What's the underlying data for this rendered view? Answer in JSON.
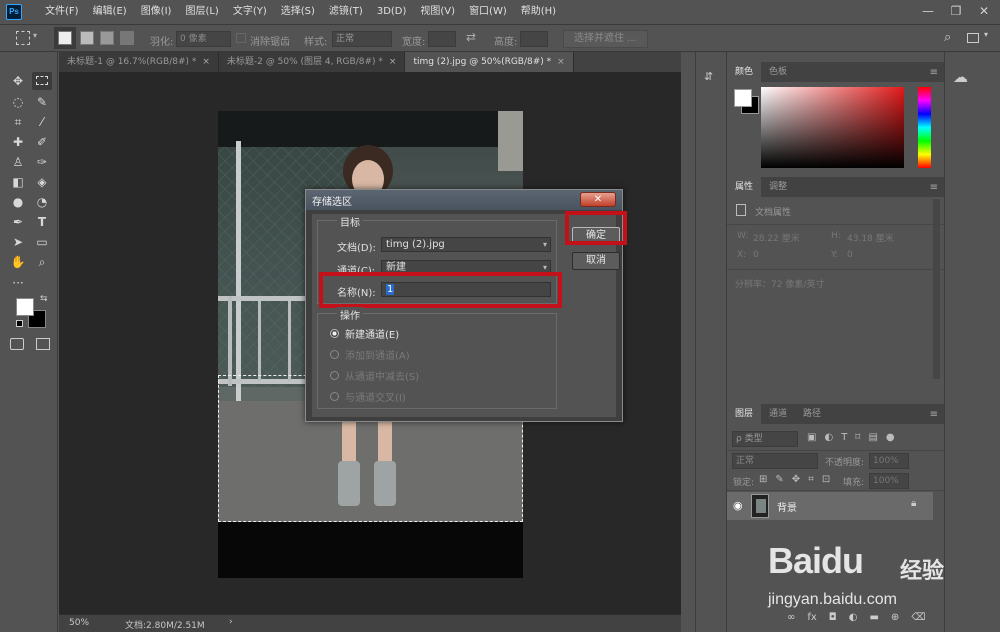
{
  "app": {
    "logo": "Ps"
  },
  "menu": [
    "文件(F)",
    "编辑(E)",
    "图像(I)",
    "图层(L)",
    "文字(Y)",
    "选择(S)",
    "滤镜(T)",
    "3D(D)",
    "视图(V)",
    "窗口(W)",
    "帮助(H)"
  ],
  "window_controls": {
    "minimize": "—",
    "restore": "❐",
    "close": "✕"
  },
  "options": {
    "feather_label": "羽化:",
    "feather_value": "0 像素",
    "antialias_label": "消除锯齿",
    "style_label": "样式:",
    "style_value": "正常",
    "width_label": "宽度:",
    "height_label": "高度:",
    "select_mask": "选择并遮住 ..."
  },
  "tabs": [
    {
      "label": "未标题-1 @ 16.7%(RGB/8#) *",
      "active": false
    },
    {
      "label": "未标题-2 @ 50% (图层 4, RGB/8#) *",
      "active": false
    },
    {
      "label": "timg (2).jpg @ 50%(RGB/8#) *",
      "active": true
    }
  ],
  "tab_close": "×",
  "status": {
    "zoom": "50%",
    "doc": "文档:2.80M/2.51M",
    "arrow": "›"
  },
  "panels": {
    "color_tabs": [
      "颜色",
      "色板"
    ],
    "props_tabs": [
      "属性",
      "调整"
    ],
    "doc_props": "文档属性",
    "w_label": "W:",
    "w_value": "28.22 厘米",
    "h_label": "H:",
    "h_value": "43.18 厘米",
    "x_label": "X:",
    "x_value": "0",
    "y_label": "Y:",
    "y_value": "0",
    "resolution": "分辨率：72 像素/英寸",
    "layers_tabs": [
      "图层",
      "通道",
      "路径"
    ],
    "kind": "ρ 类型",
    "blend_mode": "正常",
    "opacity_label": "不透明度:",
    "opacity_value": "100%",
    "lock_label": "锁定:",
    "fill_label": "填充:",
    "fill_value": "100%",
    "layer_name": "背景"
  },
  "dialog": {
    "title": "存储选区",
    "close": "✕",
    "dest_title": "目标",
    "doc_label": "文档(D):",
    "doc_value": "timg (2).jpg",
    "channel_label": "通道(C):",
    "channel_value": "新建",
    "name_label": "名称(N):",
    "name_value": "1",
    "op_title": "操作",
    "ops": [
      "新建通道(E)",
      "添加到通道(A)",
      "从通道中减去(S)",
      "与通道交叉(I)"
    ],
    "ok": "确定",
    "cancel": "取消"
  },
  "watermark": {
    "brand": "Baidu",
    "cn": "经验",
    "url": "jingyan.baidu.com"
  }
}
